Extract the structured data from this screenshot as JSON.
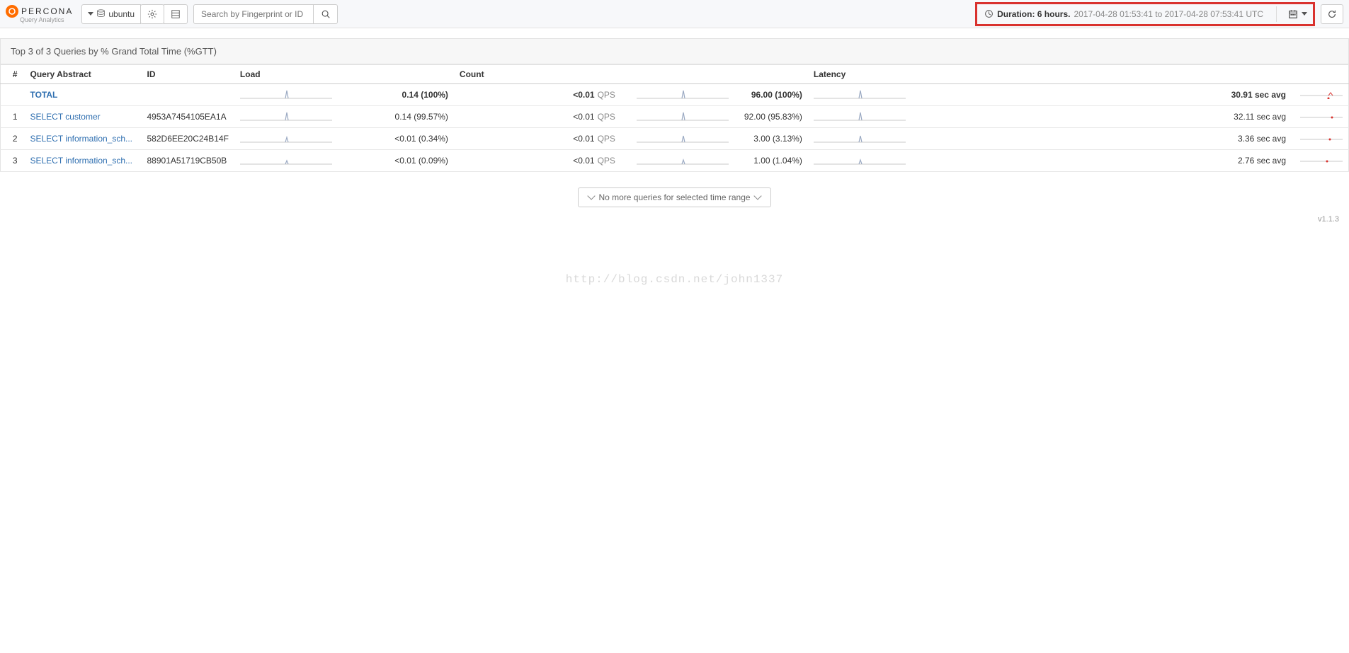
{
  "brand": {
    "name": "PERCONA",
    "subtitle": "Query Analytics"
  },
  "db_selector": {
    "label": "ubuntu"
  },
  "search": {
    "placeholder": "Search by Fingerprint or ID"
  },
  "duration": {
    "label": "Duration: 6 hours.",
    "range": "2017-04-28 01:53:41 to 2017-04-28 07:53:41 UTC"
  },
  "panel_title": "Top 3 of 3 Queries by % Grand Total Time (%GTT)",
  "columns": {
    "idx": "#",
    "qa": "Query Abstract",
    "id": "ID",
    "load": "Load",
    "count": "Count",
    "latency": "Latency"
  },
  "total_row": {
    "label": "TOTAL",
    "load_value": "0.14 (100%)",
    "count_left": "<0.01",
    "qps": "QPS",
    "count_value": "96.00 (100%)",
    "latency_value": "30.91 sec avg"
  },
  "rows": [
    {
      "idx": "1",
      "qa": "SELECT customer",
      "id": "4953A7454105EA1A",
      "load": "0.14 (99.57%)",
      "count_left": "<0.01",
      "qps": "QPS",
      "count": "92.00 (95.83%)",
      "latency": "32.11 sec avg"
    },
    {
      "idx": "2",
      "qa": "SELECT information_sch...",
      "id": "582D6EE20C24B14F",
      "load": "<0.01 (0.34%)",
      "count_left": "<0.01",
      "qps": "QPS",
      "count": "3.00 (3.13%)",
      "latency": "3.36 sec avg"
    },
    {
      "idx": "3",
      "qa": "SELECT information_sch...",
      "id": "88901A51719CB50B",
      "load": "<0.01 (0.09%)",
      "count_left": "<0.01",
      "qps": "QPS",
      "count": "1.00 (1.04%)",
      "latency": "2.76 sec avg"
    }
  ],
  "no_more": "No more queries for selected time range",
  "version": "v1.1.3",
  "watermark": "http://blog.csdn.net/john1337"
}
